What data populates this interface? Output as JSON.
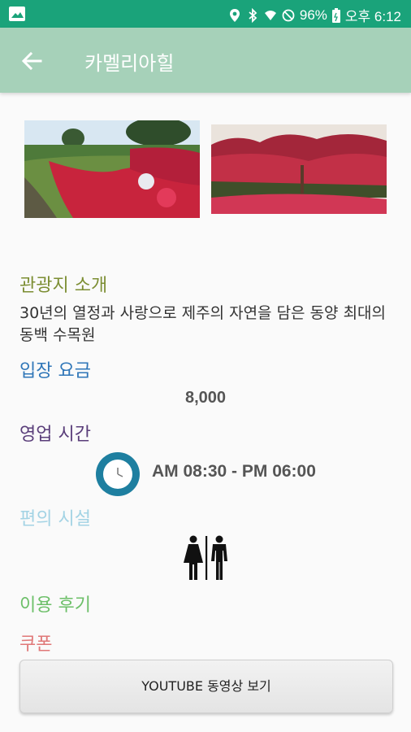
{
  "status_bar": {
    "battery": "96%",
    "time": "오후 6:12",
    "icons": [
      "image-icon",
      "location-icon",
      "bluetooth-icon",
      "wifi-icon",
      "dnd-icon",
      "battery-icon"
    ]
  },
  "toolbar": {
    "title": "카멜리아힐",
    "back_icon": "arrow-left-icon"
  },
  "sections": {
    "intro_heading": "관광지 소개",
    "intro_text": "30년의 열정과 사랑으로 제주의 자연을 담은 동양 최대의 동백 수목원",
    "fee_heading": "입장 요금",
    "fee_value": "8,000",
    "hours_heading": "영업 시간",
    "hours_value": "AM 08:30 - PM 06:00",
    "facilities_heading": "편의 시설",
    "review_heading": "이용 후기",
    "coupon_heading": "쿠폰"
  },
  "youtube_button": "YOUTUBE 동영상 보기",
  "colors": {
    "status_bar": "#1aa37a",
    "toolbar": "#a6d1b9",
    "intro": "#7c8e33",
    "fee": "#2f76b8",
    "hours": "#5a3e7a",
    "facilities": "#a3d3e4",
    "review": "#6cbf68",
    "coupon": "#e07878"
  }
}
